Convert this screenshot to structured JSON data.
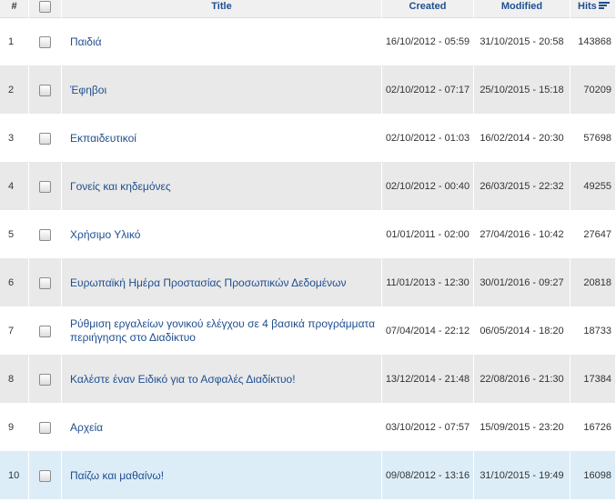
{
  "header": {
    "num": "#",
    "title": "Title",
    "created": "Created",
    "modified": "Modified",
    "hits": "Hits",
    "sort_icon": "sort-descending-icon"
  },
  "rows": [
    {
      "num": "1",
      "title": "Παιδιά",
      "created": "16/10/2012 - 05:59",
      "modified": "31/10/2015 - 20:58",
      "hits": "143868"
    },
    {
      "num": "2",
      "title": "Έφηβοι",
      "created": "02/10/2012 - 07:17",
      "modified": "25/10/2015 - 15:18",
      "hits": "70209"
    },
    {
      "num": "3",
      "title": "Εκπαιδευτικοί",
      "created": "02/10/2012 - 01:03",
      "modified": "16/02/2014 - 20:30",
      "hits": "57698"
    },
    {
      "num": "4",
      "title": "Γονείς και κηδεμόνες",
      "created": "02/10/2012 - 00:40",
      "modified": "26/03/2015 - 22:32",
      "hits": "49255"
    },
    {
      "num": "5",
      "title": "Χρήσιμο Υλικό",
      "created": "01/01/2011 - 02:00",
      "modified": "27/04/2016 - 10:42",
      "hits": "27647"
    },
    {
      "num": "6",
      "title": "Ευρωπαϊκή Ημέρα Προστασίας Προσωπικών Δεδομένων",
      "created": "11/01/2013 - 12:30",
      "modified": "30/01/2016 - 09:27",
      "hits": "20818"
    },
    {
      "num": "7",
      "title": "Ρύθμιση εργαλείων γονικού ελέγχου σε 4 βασικά προγράμματα περιήγησης στο Διαδίκτυο",
      "created": "07/04/2014 - 22:12",
      "modified": "06/05/2014 - 18:20",
      "hits": "18733"
    },
    {
      "num": "8",
      "title": "Καλέστε έναν Ειδικό για το Ασφαλές Διαδίκτυο!",
      "created": "13/12/2014 - 21:48",
      "modified": "22/08/2016 - 21:30",
      "hits": "17384"
    },
    {
      "num": "9",
      "title": "Αρχεία",
      "created": "03/10/2012 - 07:57",
      "modified": "15/09/2015 - 23:20",
      "hits": "16726"
    },
    {
      "num": "10",
      "title": "Παίζω και μαθαίνω!",
      "created": "09/08/2012 - 13:16",
      "modified": "31/10/2015 - 19:49",
      "hits": "16098"
    }
  ],
  "colors": {
    "link": "#1f4f8f",
    "row_even": "#e9e9e9",
    "row_hover": "#dcedf8",
    "header_bg": "#f0f0f0"
  }
}
